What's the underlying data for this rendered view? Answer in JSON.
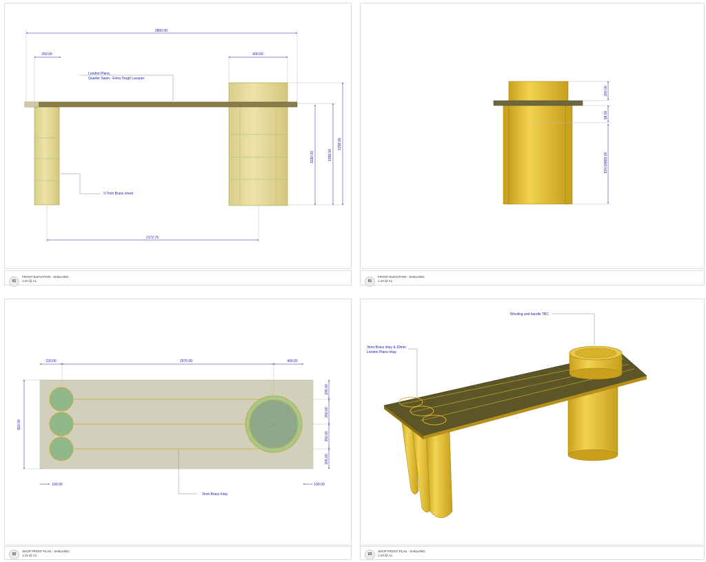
{
  "panels": [
    {
      "number": "01",
      "title": "FRONT ELEVATION - SHELVING",
      "scale": "1:10 @ A1",
      "dims": {
        "overall": "2800.00",
        "left_offset": "250.00",
        "cyl_width": "600.00",
        "bottom": "2172.76",
        "h1": "1030.00",
        "h2": "1058.00",
        "h3": "1258.00"
      },
      "annotations": {
        "wood_line1": "London Plane,",
        "wood_line2": "Quarter Sawn - Extra Tough Lacquer",
        "brass": "0.7mm Brass sheet"
      }
    },
    {
      "number": "01",
      "title": "FRONT ELEVATION - SHELVING",
      "scale": "1:10 @ A1",
      "dims": {
        "top": "200.00",
        "mid": "58.00",
        "low": "834.09869.00"
      }
    },
    {
      "number": "02",
      "title": "SHOP FRONT PLAN - SHELVING",
      "scale": "1:10 @ A1",
      "dims": {
        "d220": "220.00",
        "d2570": "2570.00",
        "d400": "400.00",
        "d910": "910.00",
        "d205a": "205.00",
        "d250a": "250.00",
        "d250b": "250.00",
        "d205b": "205.00",
        "d100a": "100.00",
        "d100b": "100.00"
      },
      "annotations": {
        "inlay": "3mm Brass Inlay"
      }
    },
    {
      "number": "03",
      "title": "SHOP FRONT PLAN - SHELVING",
      "scale": "1:10 @ A1",
      "annotations": {
        "wording": "Wording and handle TBC",
        "inlay_line1": "3mm Brass inlay & 10mm",
        "inlay_line2": "London Plane Inlay"
      }
    }
  ],
  "colors": {
    "brass": "#d8b22a",
    "brass_dark": "#b08c18",
    "wood_top": "#5a5428",
    "plan_bg": "#d3cfbd",
    "dim": "#1a1aa8",
    "green": "#a3c98f"
  }
}
